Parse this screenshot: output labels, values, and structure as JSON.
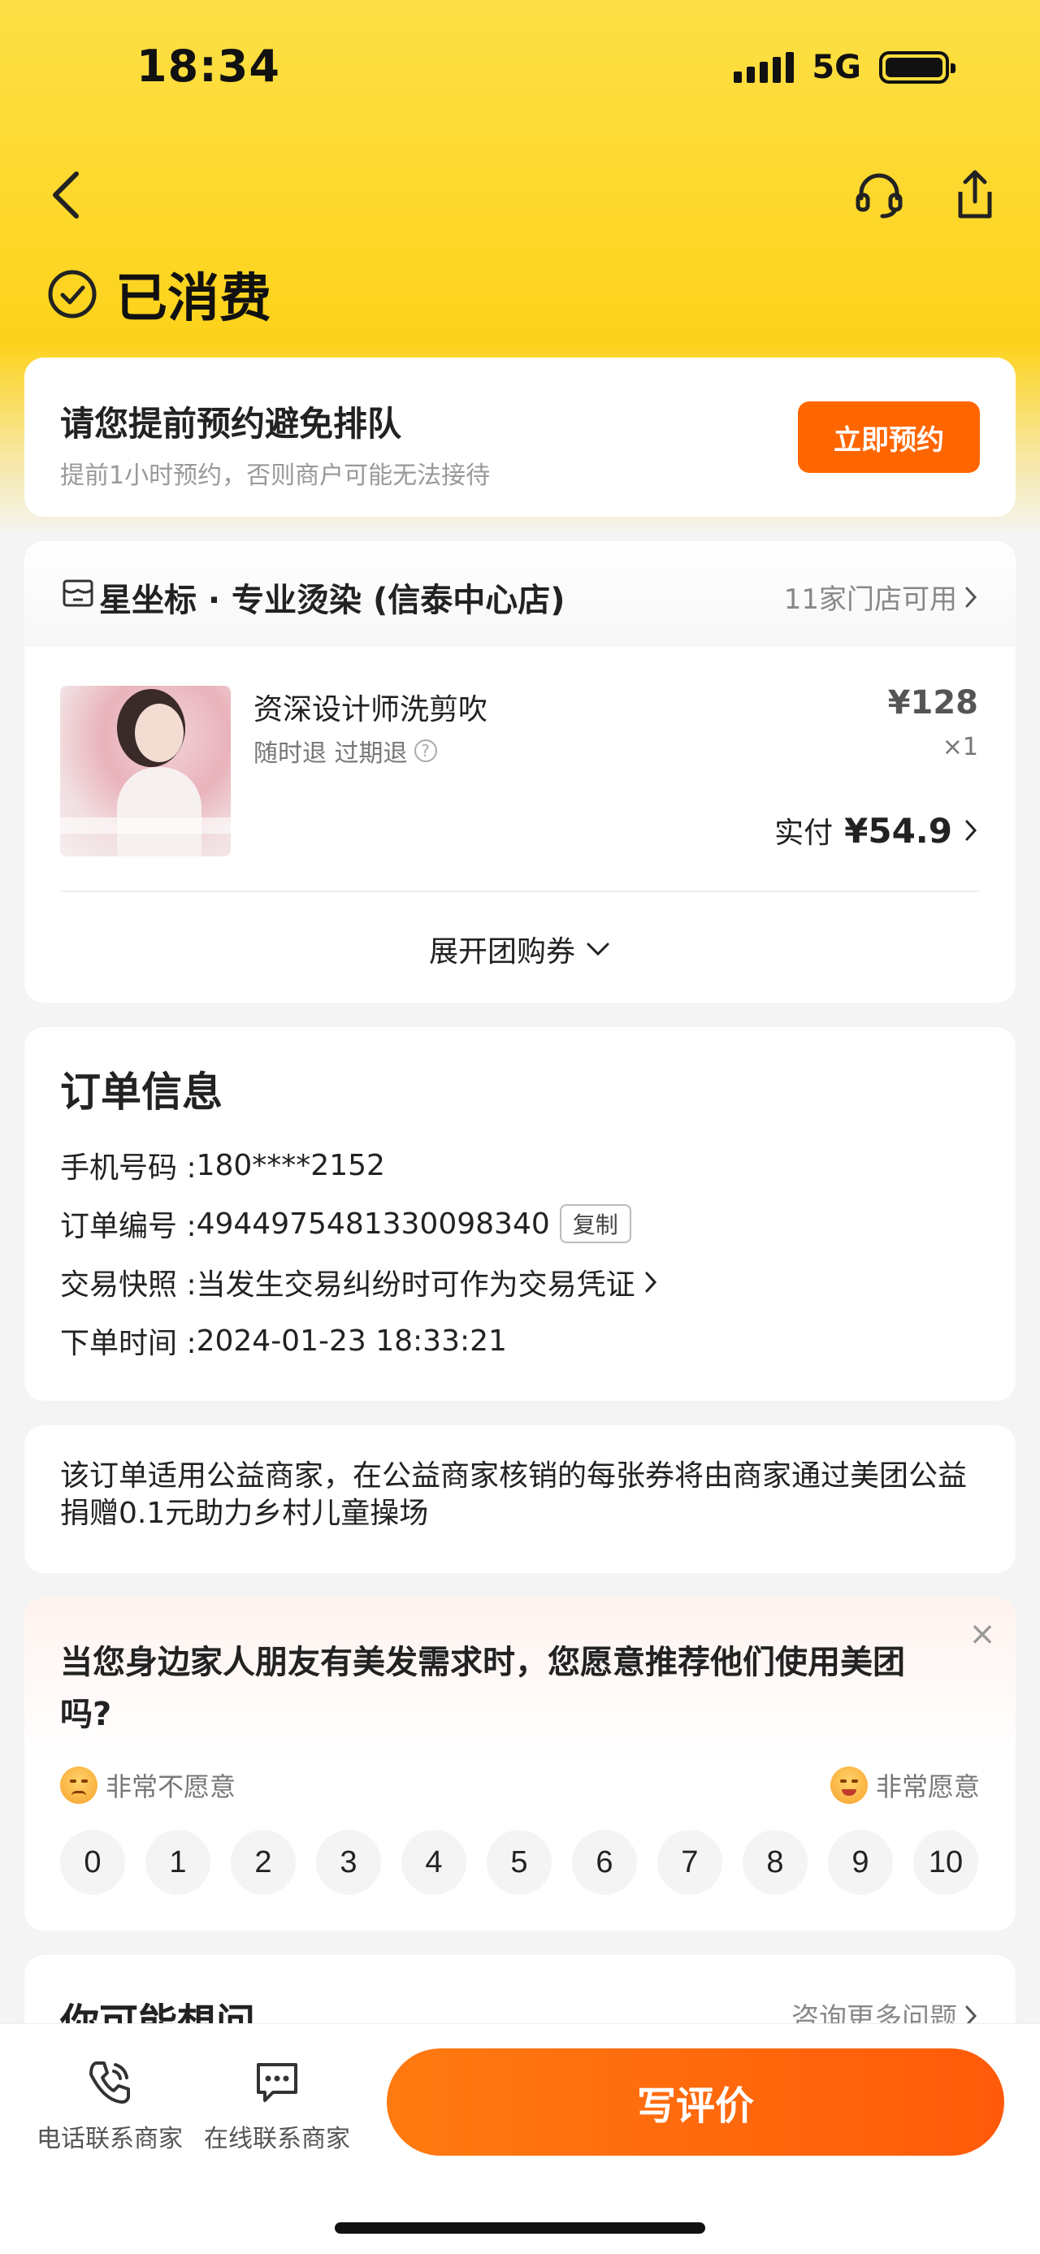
{
  "status_bar": {
    "time": "18:34",
    "network": "5G"
  },
  "header": {
    "status_title": "已消费"
  },
  "booking": {
    "title": "请您提前预约避免排队",
    "subtitle": "提前1小时预约，否则商户可能无法接待",
    "button": "立即预约"
  },
  "store": {
    "name": "星坐标 · 专业烫染 (信泰中心店)",
    "availability": "11家门店可用",
    "product": {
      "name": "资深设计师洗剪吹",
      "tags": "随时退 过期退",
      "price": "¥128",
      "quantity": "×1",
      "paid_label": "实付",
      "paid_amount": "¥54.9"
    },
    "expand_label": "展开团购券"
  },
  "order_info": {
    "title": "订单信息",
    "phone_label": "手机号码 : ",
    "phone_value": "180****2152",
    "order_no_label": "订单编号 : ",
    "order_no_value": "4944975481330098340",
    "copy_label": "复制",
    "snapshot_label": "交易快照 : ",
    "snapshot_value": "当发生交易纠纷时可作为交易凭证",
    "time_label": "下单时间 : ",
    "time_value": "2024-01-23 18:33:21"
  },
  "charity": {
    "text": "该订单适用公益商家，在公益商家核销的每张券将由商家通过美团公益捐赠0.1元助力乡村儿童操场"
  },
  "survey": {
    "question": "当您身边家人朋友有美发需求时，您愿意推荐他们使用美团吗?",
    "low_label": "非常不愿意",
    "high_label": "非常愿意",
    "scores": [
      "0",
      "1",
      "2",
      "3",
      "4",
      "5",
      "6",
      "7",
      "8",
      "9",
      "10"
    ]
  },
  "faq": {
    "title": "你可能想问",
    "more": "咨询更多问题"
  },
  "bottom_bar": {
    "phone_label": "电话联系商家",
    "chat_label": "在线联系商家",
    "review_button": "写评价"
  },
  "colors": {
    "accent": "#ff6600",
    "header_yellow": "#fdd21a"
  }
}
